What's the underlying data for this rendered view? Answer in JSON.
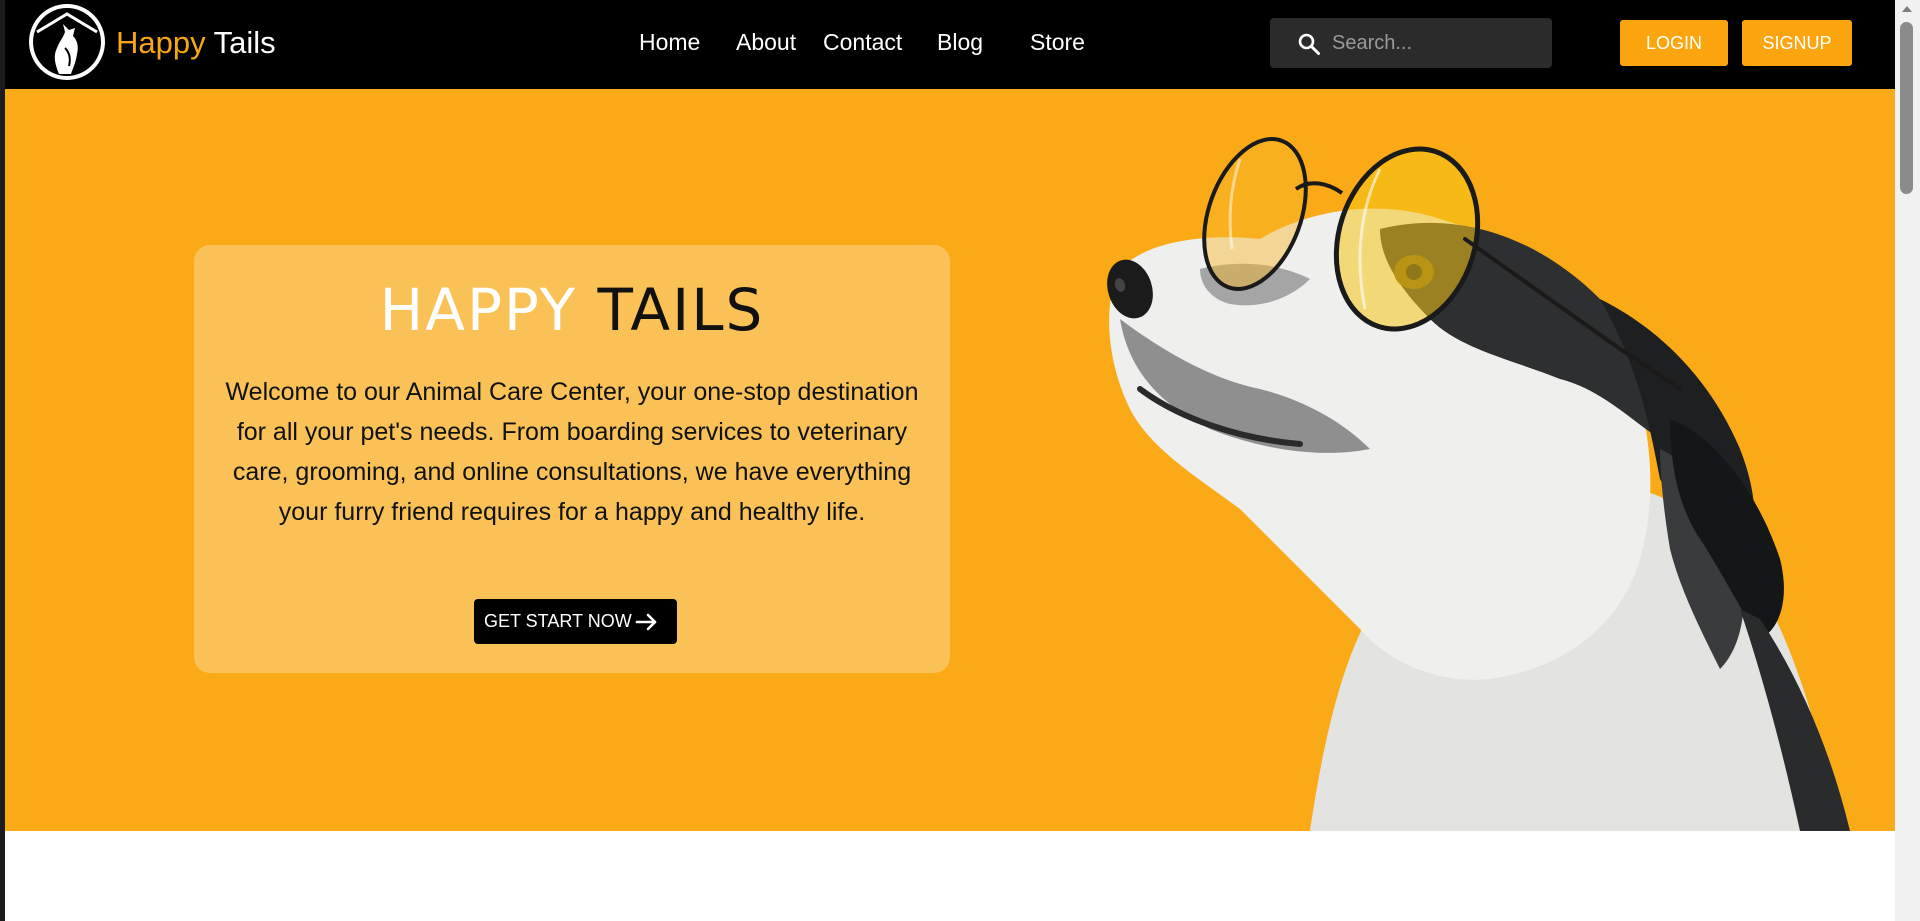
{
  "brand": {
    "name_part1": "Happy",
    "name_part2": "Tails",
    "logo_icon": "dog-silhouette-icon",
    "accent_color": "#f7a716"
  },
  "nav": {
    "links": [
      "Home",
      "About",
      "Contact",
      "Blog",
      "Store"
    ]
  },
  "search": {
    "placeholder": "Search...",
    "value": "",
    "icon": "search-icon"
  },
  "auth": {
    "login_label": "LOGIN",
    "signup_label": "SIGNUP",
    "button_color": "#fca50e"
  },
  "hero": {
    "title_part1": "HAPPY",
    "title_part2": "TAILS",
    "description": "Welcome to our Animal Care Center, your one-stop destination for all your pet's needs. From boarding services to veterinary care, grooming, and online consultations, we have everything your furry friend requires for a happy and healthy life.",
    "cta_label": "GET START NOW",
    "cta_icon": "arrow-right-icon",
    "background_color": "#f9aa16",
    "image_subject": "dog-with-round-glasses"
  }
}
